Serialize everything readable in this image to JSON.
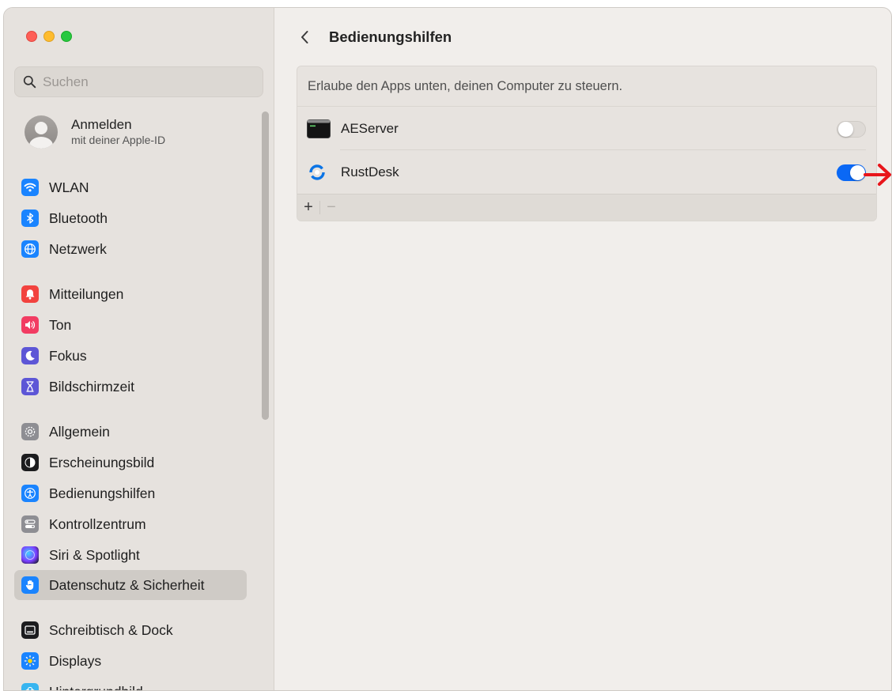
{
  "window": {
    "controls": [
      "close",
      "minimize",
      "zoom"
    ]
  },
  "search": {
    "placeholder": "Suchen",
    "value": ""
  },
  "account": {
    "name": "Anmelden",
    "subtitle": "mit deiner Apple-ID"
  },
  "sidebar": {
    "items": [
      {
        "label": "WLAN",
        "icon": "wifi-icon",
        "color": "#1a84ff"
      },
      {
        "label": "Bluetooth",
        "icon": "bluetooth-icon",
        "color": "#1a84ff"
      },
      {
        "label": "Netzwerk",
        "icon": "globe-icon",
        "color": "#1a84ff"
      },
      {
        "label": "Mitteilungen",
        "icon": "bell-icon",
        "color": "#f2423e"
      },
      {
        "label": "Ton",
        "icon": "speaker-icon",
        "color": "#f23c62"
      },
      {
        "label": "Fokus",
        "icon": "moon-icon",
        "color": "#5d56d6"
      },
      {
        "label": "Bildschirmzeit",
        "icon": "hourglass-icon",
        "color": "#5d56d6"
      },
      {
        "label": "Allgemein",
        "icon": "gear-icon",
        "color": "#8e8e93"
      },
      {
        "label": "Erscheinungsbild",
        "icon": "appearance-icon",
        "color": "#1c1c1e"
      },
      {
        "label": "Bedienungshilfen",
        "icon": "accessibility-icon",
        "color": "#1a84ff"
      },
      {
        "label": "Kontrollzentrum",
        "icon": "control-center-icon",
        "color": "#8e8e93"
      },
      {
        "label": "Siri & Spotlight",
        "icon": "siri-icon",
        "color": "#2c2c48"
      },
      {
        "label": "Datenschutz & Sicherheit",
        "icon": "hand-icon",
        "color": "#1a84ff",
        "selected": true
      },
      {
        "label": "Schreibtisch & Dock",
        "icon": "dock-icon",
        "color": "#1c1c1e"
      },
      {
        "label": "Displays",
        "icon": "sun-icon",
        "color": "#1a84ff"
      },
      {
        "label": "Hintergrundbild",
        "icon": "flower-icon",
        "color": "#37b5f0"
      }
    ]
  },
  "page": {
    "title": "Bedienungshilfen",
    "description": "Erlaube den Apps unten, deinen Computer zu steuern.",
    "apps": [
      {
        "name": "AEServer",
        "icon": "terminal-icon",
        "enabled": false
      },
      {
        "name": "RustDesk",
        "icon": "rustdesk-icon",
        "enabled": true
      }
    ],
    "footer": {
      "add": "+",
      "remove": "−"
    }
  },
  "colors": {
    "accent": "#0a68f5",
    "annotation_arrow": "#e8151b"
  }
}
